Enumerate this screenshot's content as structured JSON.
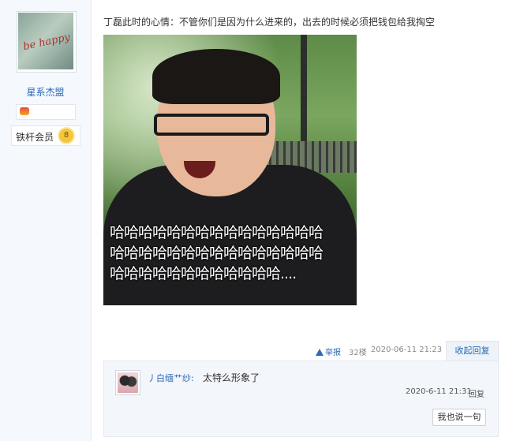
{
  "sidebar": {
    "username": "星系杰盟",
    "member_label": "铁杆会员",
    "member_level": "8",
    "avatar_script": "be happy"
  },
  "post": {
    "text": "丁磊此时的心情：不管你们是因为什么进来的，出去的时候必须把钱包给我掏空",
    "laugh_lines": [
      "哈哈哈哈哈哈哈哈哈哈哈哈哈哈哈",
      "哈哈哈哈哈哈哈哈哈哈哈哈哈哈哈",
      "哈哈哈哈哈哈哈哈哈哈哈哈...."
    ]
  },
  "meta": {
    "report": "举报",
    "floor": "32楼",
    "date": "2020-06-11 21:23",
    "collapse": "收起回复"
  },
  "reply": {
    "user": "丿白缅艹纱:",
    "text": "太特么形象了",
    "date": "2020-6-11 21:31",
    "reply_link": "回复",
    "say_button": "我也说一句"
  },
  "colors": {
    "link": "#2a6ab8",
    "sidebar_bg": "#f5f8fc",
    "reply_bg": "#f3f6fa"
  }
}
